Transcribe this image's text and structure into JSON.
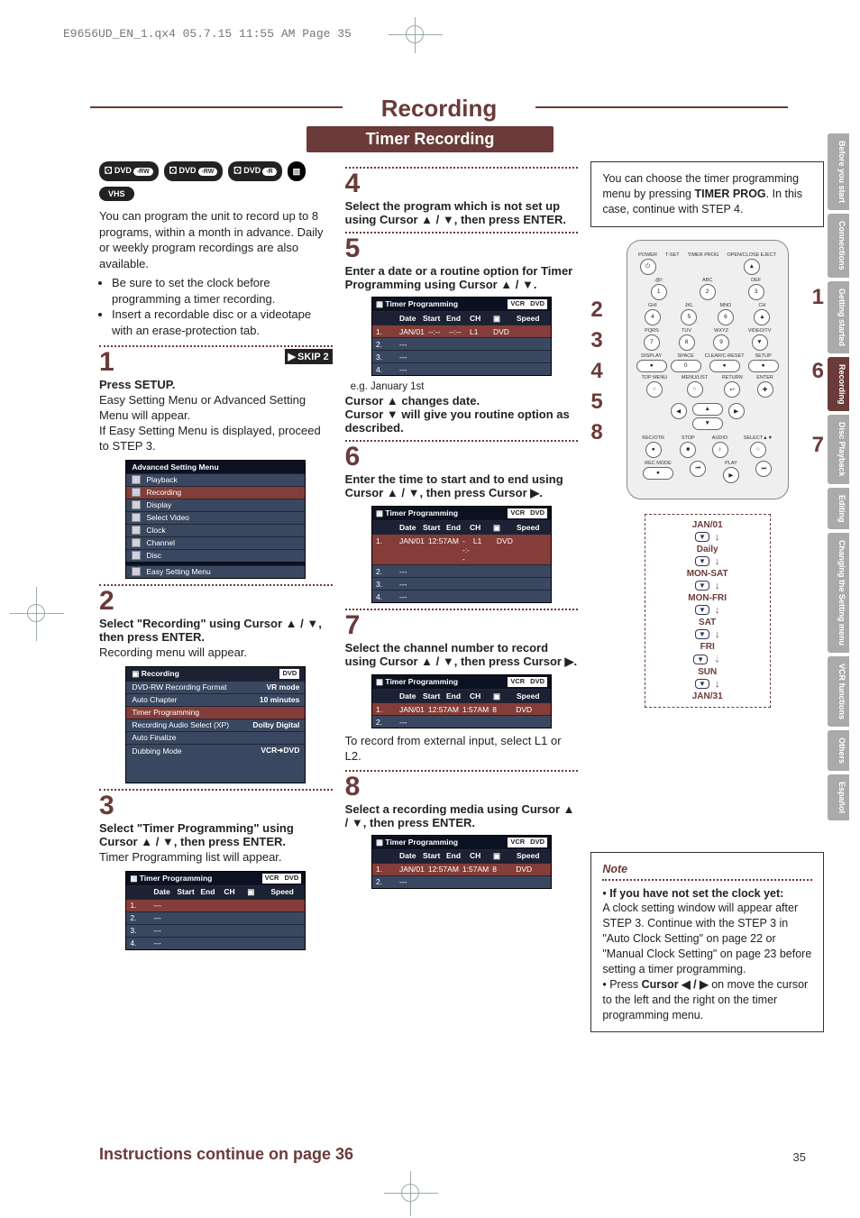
{
  "meta": {
    "file_line": "E9656UD_EN_1.qx4  05.7.15  11:55 AM  Page 35"
  },
  "title": "Recording",
  "subtitle": "Timer Recording",
  "badges": {
    "rw_video": "DVD-RW Video Mode",
    "rw_vr": "DVD-RW VR Mode",
    "r_video": "DVD+R Video Mode",
    "vhs": "VHS"
  },
  "intro_para": "You can program the unit to record up to 8 programs, within a month in advance. Daily or weekly program recordings are also available.",
  "intro_bullets": [
    "Be sure to set the clock before programming a timer recording.",
    "Insert a recordable disc or a videotape with an erase-protection tab."
  ],
  "steps": {
    "s1": {
      "num": "1",
      "skip": "SKIP 2",
      "title": "Press SETUP.",
      "desc": "Easy Setting Menu or Advanced Setting Menu will appear.\nIf Easy Setting Menu is displayed, proceed to STEP 3."
    },
    "s2": {
      "num": "2",
      "title": "Select \"Recording\" using Cursor ▲ / ▼, then press ENTER.",
      "desc": "Recording menu will appear."
    },
    "s3": {
      "num": "3",
      "title": "Select \"Timer Programming\" using Cursor ▲ / ▼, then press ENTER.",
      "desc": "Timer Programming list will appear."
    },
    "s4": {
      "num": "4",
      "title": "Select the program which is not set up using Cursor ▲ / ▼, then press ENTER."
    },
    "s5": {
      "num": "5",
      "title": "Enter a date or a routine option for Timer Programming using Cursor ▲ / ▼.",
      "caption": "e.g. January 1st",
      "after": "Cursor ▲ changes date.\nCursor ▼ will give you routine option as described."
    },
    "s6": {
      "num": "6",
      "title": "Enter the time to start and to end using Cursor ▲ / ▼, then press Cursor ▶."
    },
    "s7": {
      "num": "7",
      "title": "Select the channel number to record using Cursor ▲ / ▼, then press Cursor ▶.",
      "after": "To record from external input, select L1 or L2."
    },
    "s8": {
      "num": "8",
      "title": "Select a recording media using Cursor ▲ / ▼, then press ENTER."
    }
  },
  "adv_menu": {
    "head": "Advanced Setting Menu",
    "items": [
      "Playback",
      "Recording",
      "Display",
      "Select Video",
      "Clock",
      "Channel",
      "Disc"
    ],
    "footer": "Easy Setting Menu"
  },
  "rec_menu": {
    "head": "Recording",
    "tab": "DVD",
    "rows": [
      [
        "DVD-RW Recording Format",
        "VR mode"
      ],
      [
        "Auto Chapter",
        "10 minutes"
      ],
      [
        "Timer Programming",
        ""
      ],
      [
        "Recording Audio Select (XP)",
        "Dolby Digital"
      ],
      [
        "Auto Finalize",
        ""
      ],
      [
        "Dubbing Mode",
        "VCR➜DVD"
      ]
    ]
  },
  "tp_table": {
    "head": "Timer Programming",
    "cols": [
      "Date",
      "Start",
      "End",
      "CH",
      "DVD/VCR",
      "Speed"
    ],
    "tabs": [
      "VCR",
      "DVD"
    ],
    "empty": "---",
    "r5": {
      "date": "JAN/01",
      "start": "--:--",
      "end": "--:--",
      "ch": "L1",
      "media": "DVD"
    },
    "r6": {
      "date": "JAN/01",
      "start": "12:57AM",
      "end": "--:--",
      "ch": "L1",
      "media": "DVD"
    },
    "r7": {
      "date": "JAN/01",
      "start": "12:57AM",
      "end": "1:57AM",
      "ch": "8",
      "media": "DVD"
    },
    "r8": {
      "date": "JAN/01",
      "start": "12:57AM",
      "end": "1:57AM",
      "ch": "8",
      "media": "DVD"
    }
  },
  "tip_box": "You can choose the timer programming menu by pressing TIMER PROG. In this case, continue with STEP 4.",
  "remote_link_left": [
    "2",
    "3",
    "4",
    "5",
    "8"
  ],
  "remote_link_right": [
    "1",
    "6",
    "7"
  ],
  "routine_diagram": [
    "JAN/01",
    "Daily",
    "MON-SAT",
    "MON-FRI",
    "SAT",
    "FRI",
    "SUN",
    "JAN/31"
  ],
  "note": {
    "head": "Note",
    "bold": "If you have not set the clock yet:",
    "p1": "A clock setting window will appear after STEP 3. Continue with the STEP 3 in \"Auto Clock Setting\" on page 22 or \"Manual Clock Setting\" on page 23 before setting a timer programming.",
    "p2": "Press Cursor ◀ / ▶ on move the cursor to the left and the right on the timer programming menu."
  },
  "side_tabs": [
    "Before you start",
    "Connections",
    "Getting started",
    "Recording",
    "Disc Playback",
    "Editing",
    "Changing the Setting menu",
    "VCR functions",
    "Others",
    "Español"
  ],
  "side_active_index": 3,
  "footer": {
    "cont": "Instructions continue on page 36",
    "page": "35"
  },
  "chart_data": {
    "type": "table",
    "title": "Timer Programming on-screen tables",
    "columns": [
      "Date",
      "Start",
      "End",
      "CH",
      "Media",
      "Speed"
    ],
    "rows": [
      [
        "JAN/01",
        "--:--",
        "--:--",
        "L1",
        "DVD",
        ""
      ],
      [
        "JAN/01",
        "12:57AM",
        "--:--",
        "L1",
        "DVD",
        ""
      ],
      [
        "JAN/01",
        "12:57AM",
        "1:57AM",
        "8",
        "DVD",
        ""
      ],
      [
        "JAN/01",
        "12:57AM",
        "1:57AM",
        "8",
        "DVD",
        ""
      ]
    ]
  }
}
